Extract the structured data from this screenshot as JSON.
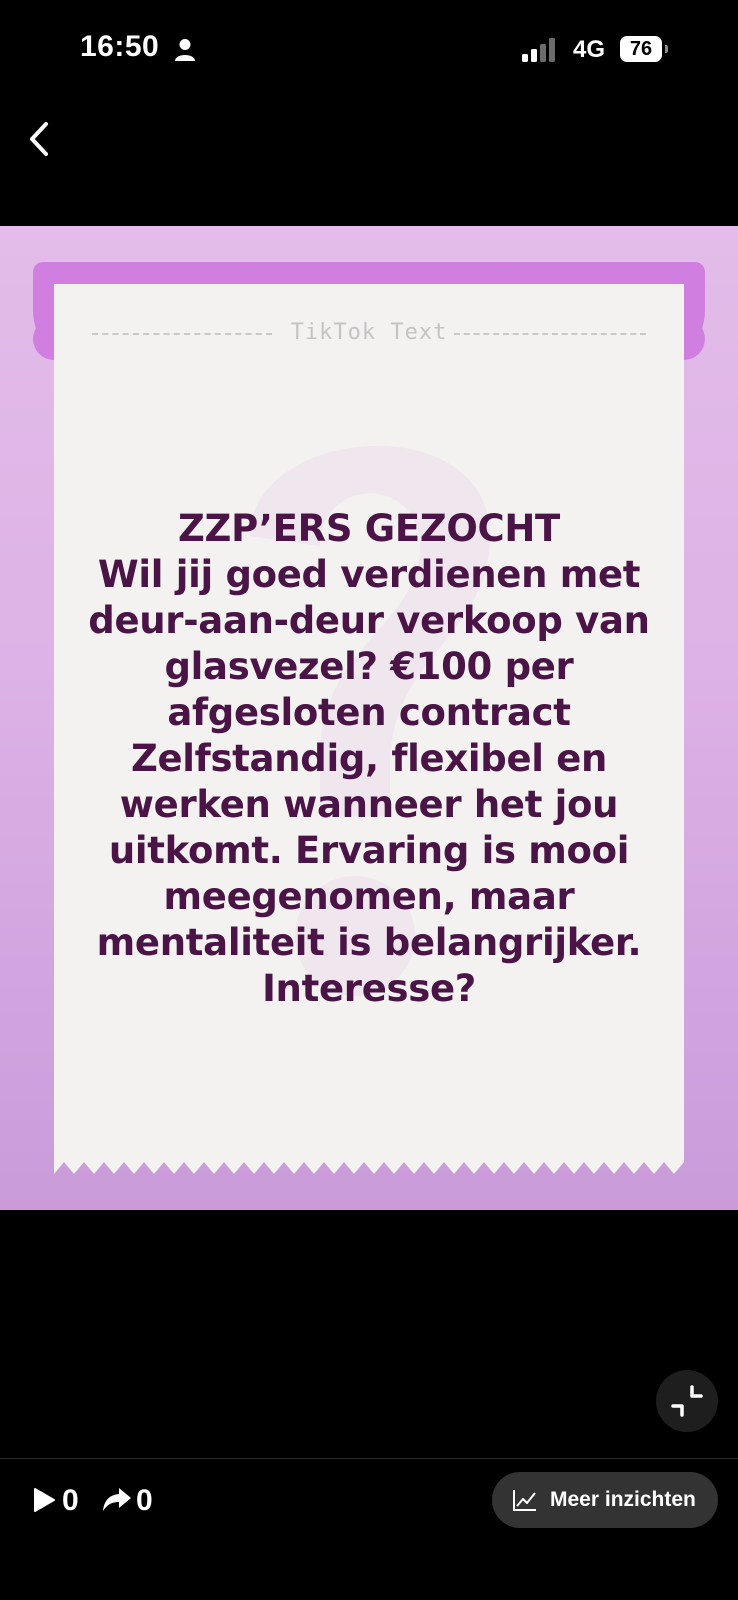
{
  "status_bar": {
    "time": "16:50",
    "network": "4G",
    "battery": "76"
  },
  "post": {
    "header_label": "TikTok Text",
    "text": "ZZP’ERS GEZOCHT\nWil jij goed verdienen met deur-aan-deur verkoop van glasvezel? €100 per afgesloten contract Zelfstandig, flexibel en werken wanneer het jou uitkomt. Ervaring is mooi meegenomen, maar mentaliteit is belangrijker. Interesse?"
  },
  "stats": {
    "plays": "0",
    "shares": "0"
  },
  "insights_button": {
    "label": "Meer inzichten"
  },
  "colors": {
    "background": "#000000",
    "clip": "#d07fe0",
    "paper": "#f3f2f0",
    "text": "#4a1546"
  },
  "icons": [
    "person-icon",
    "signal-icon",
    "back-chevron-icon",
    "collapse-icon",
    "play-icon",
    "share-icon",
    "chart-line-icon"
  ]
}
